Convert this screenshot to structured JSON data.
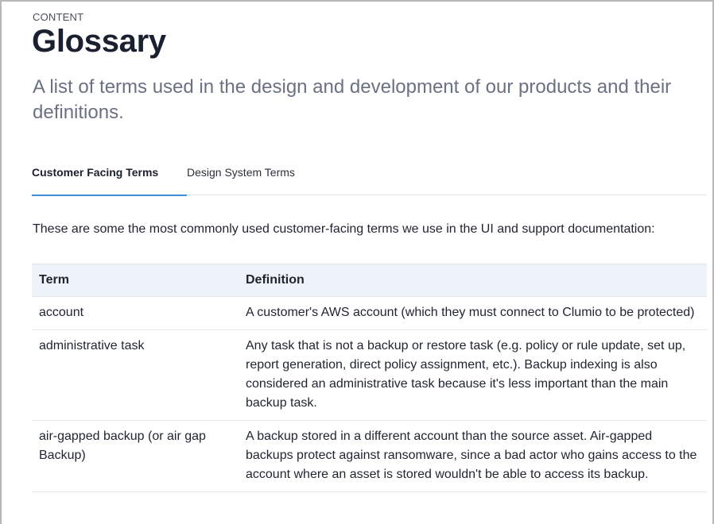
{
  "header": {
    "eyebrow": "CONTENT",
    "title": "Glossary",
    "subtitle": "A list of terms used in the design and development of our products and their definitions."
  },
  "tabs": [
    {
      "label": "Customer Facing Terms",
      "active": true
    },
    {
      "label": "Design System Terms",
      "active": false
    }
  ],
  "intro": "These are some the most commonly used customer-facing terms we use in the UI and support documentation:",
  "table": {
    "columns": [
      "Term",
      "Definition"
    ],
    "rows": [
      {
        "term": "account",
        "definition": "A customer's AWS account (which they must connect to Clumio to be protected)"
      },
      {
        "term": "administrative task",
        "definition": "Any task that is not a backup or restore task (e.g. policy or rule update, set up, report generation, direct policy assignment, etc.). Backup indexing is also considered an administrative task because it's less important than the main backup task."
      },
      {
        "term": "air-gapped backup (or air gap Backup)",
        "definition": "A backup stored in a different account than the source asset. Air-gapped backups protect against ransomware, since a bad actor who gains access to the account where an asset is stored wouldn't be able to access its backup."
      }
    ]
  },
  "colors": {
    "accent": "#3a8fd6",
    "heading": "#1a2030",
    "subtitle": "#6a7184",
    "table_header_bg": "#eef2f9"
  }
}
